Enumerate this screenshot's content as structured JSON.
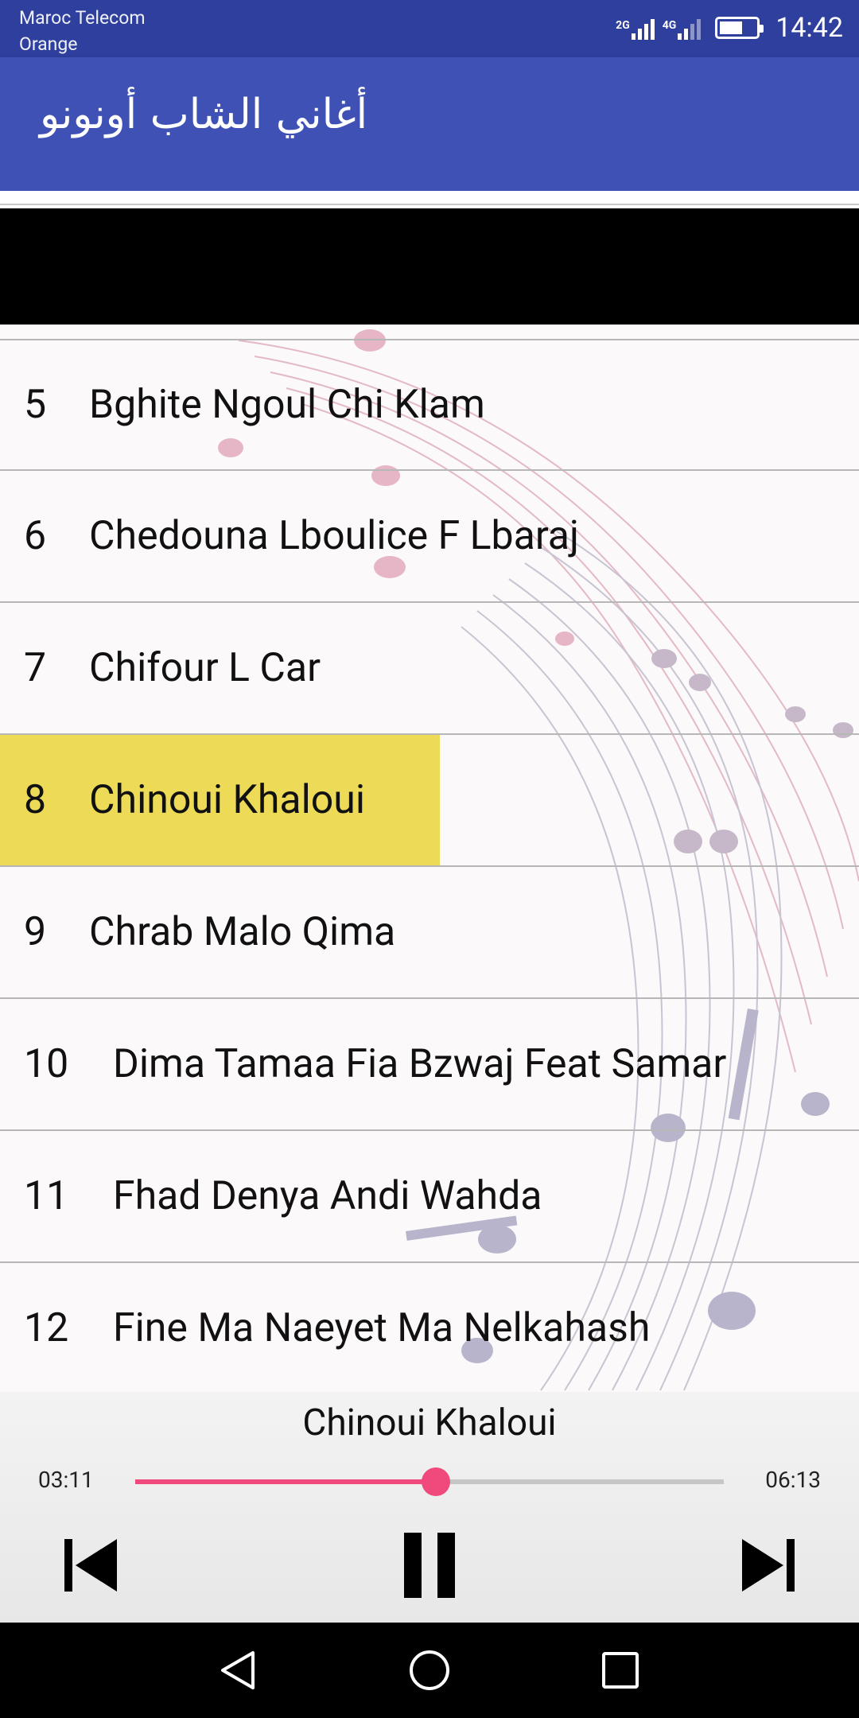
{
  "status_bar": {
    "carrier_line1": "Maroc Telecom",
    "carrier_line2": "Orange",
    "net1": "2G",
    "net2": "4G",
    "time": "14:42"
  },
  "app_bar": {
    "title": "أغاني الشاب أونونو",
    "color": "#3f51b5"
  },
  "songs": [
    {
      "number": "5",
      "title": "Bghite Ngoul Chi Klam"
    },
    {
      "number": "6",
      "title": "Chedouna Lboulice F Lbaraj"
    },
    {
      "number": "7",
      "title": "Chifour L Car"
    },
    {
      "number": "8",
      "title": "Chinoui Khaloui",
      "selected": true
    },
    {
      "number": "9",
      "title": "Chrab Malo Qima"
    },
    {
      "number": "10",
      "title": "Dima Tamaa Fia Bzwaj Feat Samar"
    },
    {
      "number": "11",
      "title": "Fhad Denya Andi Wahda"
    },
    {
      "number": "12",
      "title": "Fine Ma Naeyet Ma Nelkahash"
    }
  ],
  "player": {
    "now_playing": "Chinoui Khaloui",
    "current_time": "03:11",
    "duration": "06:13",
    "progress": 0.511,
    "accent_color": "#f04a7d",
    "prev_icon": "skip-previous-icon",
    "play_icon": "pause-icon",
    "next_icon": "skip-next-icon"
  },
  "highlight_color": "#eddb57",
  "nav": {
    "back_icon": "back-triangle-icon",
    "home_icon": "home-circle-icon",
    "recents_icon": "recents-square-icon"
  }
}
